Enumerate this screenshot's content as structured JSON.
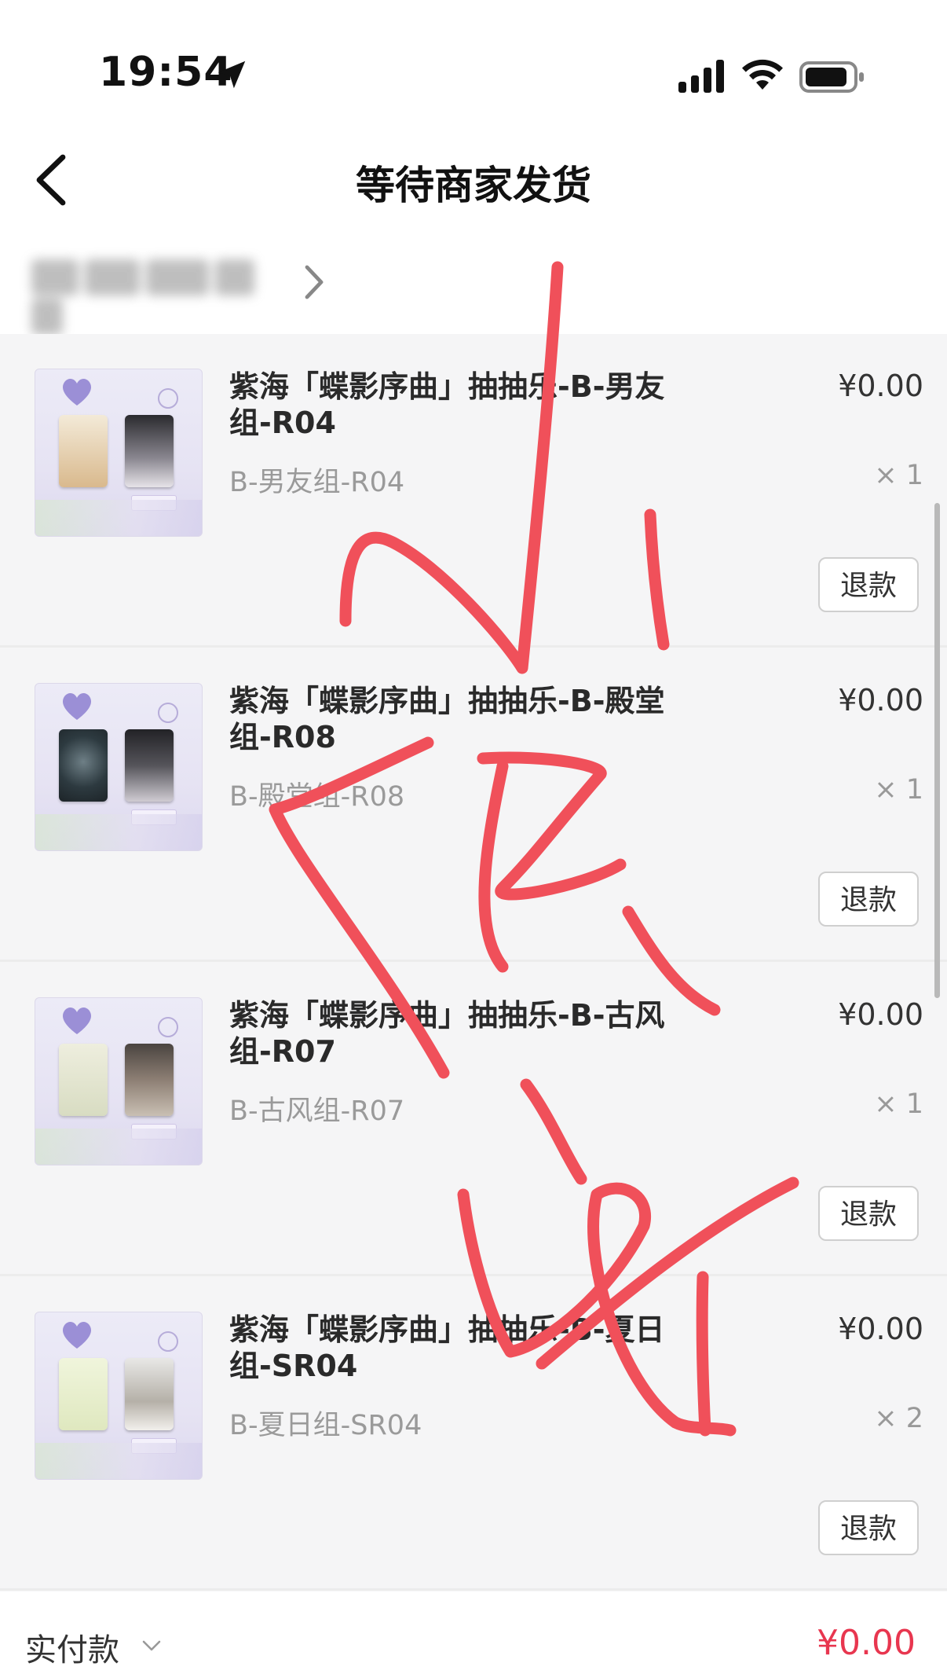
{
  "status_bar": {
    "time": "19:54",
    "icons": [
      "location-arrow-icon",
      "signal-icon",
      "wifi-icon",
      "battery-icon"
    ]
  },
  "nav": {
    "title": "等待商家发货",
    "back_icon": "chevron-left-icon"
  },
  "shop": {
    "chevron_icon": "chevron-right-icon"
  },
  "items": [
    {
      "title": "紫海「蝶影序曲」抽抽乐-B-男友组-R04",
      "spec": "B-男友组-R04",
      "price": "¥0.00",
      "qty": "× 1",
      "refund": "退款"
    },
    {
      "title": "紫海「蝶影序曲」抽抽乐-B-殿堂组-R08",
      "spec": "B-殿堂组-R08",
      "price": "¥0.00",
      "qty": "× 1",
      "refund": "退款"
    },
    {
      "title": "紫海「蝶影序曲」抽抽乐-B-古风组-R07",
      "spec": "B-古风组-R07",
      "price": "¥0.00",
      "qty": "× 1",
      "refund": "退款"
    },
    {
      "title": "紫海「蝶影序曲」抽抽乐-B-夏日组-SR04",
      "spec": "B-夏日组-SR04",
      "price": "¥0.00",
      "qty": "× 2",
      "refund": "退款"
    }
  ],
  "footer": {
    "paid_label": "实付款",
    "paid_amount": "¥0.00"
  },
  "colors": {
    "background": "#ffffff",
    "list_background": "#f5f5f6",
    "price_accent": "#e8364f",
    "annotation_stroke": "#f0505a"
  }
}
